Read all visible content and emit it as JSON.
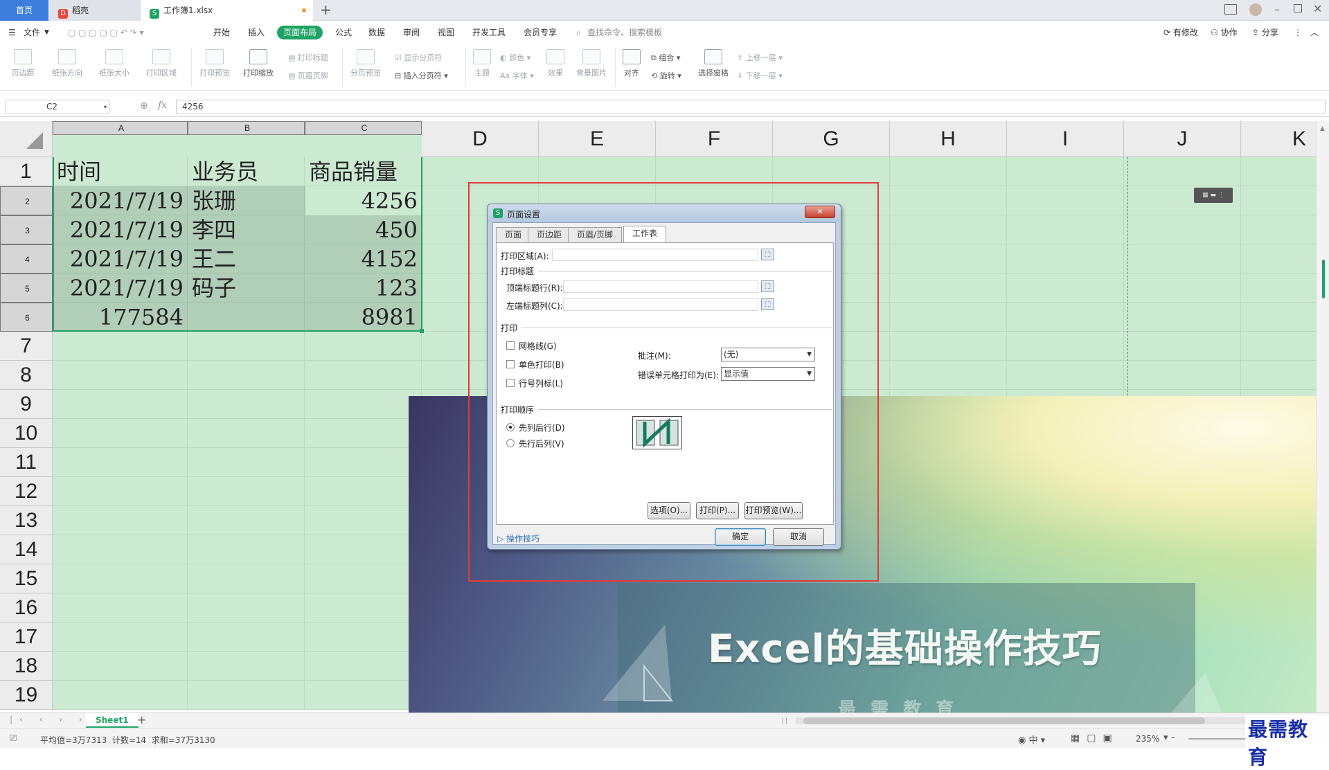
{
  "tabs": {
    "home": "首页",
    "docer": "稻壳",
    "workbook": "工作簿1.xlsx"
  },
  "menu": {
    "file": "文件",
    "start": "开始",
    "insert": "插入",
    "page_layout": "页面布局",
    "formula": "公式",
    "data": "数据",
    "review": "审阅",
    "view": "视图",
    "dev": "开发工具",
    "member": "会员专享",
    "search": "查找命令、搜索模板",
    "modified": "有修改",
    "collab": "协作",
    "share": "分享"
  },
  "toolbar": {
    "margin": "页边距",
    "orient": "纸张方向",
    "size": "纸张大小",
    "area": "打印区域",
    "preview": "打印预览",
    "scale": "打印缩放",
    "print_title": "打印标题",
    "header_footer": "页眉页脚",
    "page_break_preview": "分页预览",
    "show_breaks": "显示分页符",
    "insert_break": "插入分页符",
    "theme": "主题",
    "color": "颜色",
    "font": "字体",
    "effect": "效果",
    "bg": "背景图片",
    "align": "对齐",
    "group": "组合",
    "rotate": "旋转",
    "select_pane": "选择窗格",
    "bring_fwd": "上移一层",
    "send_back": "下移一层"
  },
  "formula": {
    "name": "C2",
    "value": "4256",
    "fx": "fx"
  },
  "columns": [
    "A",
    "B",
    "C",
    "D",
    "E",
    "F",
    "G",
    "H",
    "I",
    "J",
    "K"
  ],
  "rows": [
    "1",
    "2",
    "3",
    "4",
    "5",
    "6",
    "7",
    "8",
    "9",
    "10",
    "11",
    "12",
    "13",
    "14",
    "15",
    "16",
    "17",
    "18",
    "19"
  ],
  "cells": {
    "header": [
      "时间",
      "业务员",
      "商品销量"
    ],
    "data": [
      [
        "2021/7/19",
        "张珊",
        "4256"
      ],
      [
        "2021/7/19",
        "李四",
        "450"
      ],
      [
        "2021/7/19",
        "王二",
        "4152"
      ],
      [
        "2021/7/19",
        "码子",
        "123"
      ],
      [
        "177584",
        "",
        "8981"
      ]
    ]
  },
  "dialog": {
    "title": "页面设置",
    "tabs": [
      "页面",
      "页边距",
      "页眉/页脚",
      "工作表"
    ],
    "print_area": "打印区域(A):",
    "print_titles": "打印标题",
    "top_rows": "顶端标题行(R):",
    "left_cols": "左端标题列(C):",
    "print": "打印",
    "gridlines": "网格线(G)",
    "mono": "单色打印(B)",
    "row_col": "行号列标(L)",
    "comments": "批注(M):",
    "comments_val": "(无)",
    "errors": "错误单元格打印为(E):",
    "errors_val": "显示值",
    "order": "打印顺序",
    "down_over": "先列后行(D)",
    "over_down": "先行后列(V)",
    "options_btn": "选项(O)...",
    "print_btn": "打印(P)...",
    "preview_btn": "打印预览(W)...",
    "tips": "操作技巧",
    "ok": "确定",
    "cancel": "取消"
  },
  "slide": {
    "title": "Excel的基础操作技巧",
    "subtitle": "最 需 教 育"
  },
  "sheet": {
    "name": "Sheet1"
  },
  "status": {
    "text": "平均值=3万7313  计数=14  求和=37万3130",
    "zoom": "235%"
  },
  "watermark": "最需教育",
  "colors": {
    "accent": "#1fa365",
    "tab_blue": "#3d7ddb",
    "grid_bg": "#ccead2",
    "red_frame": "#e23a3a"
  }
}
